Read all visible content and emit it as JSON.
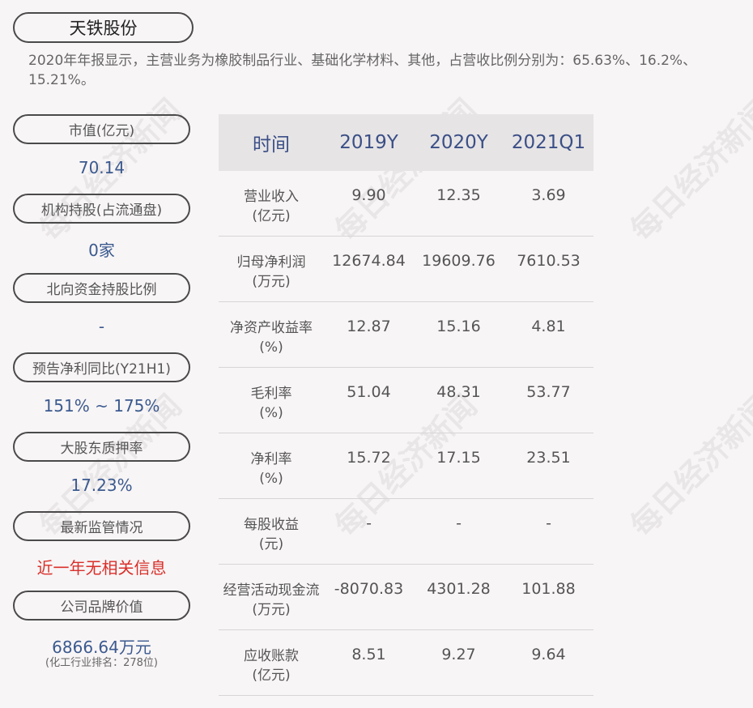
{
  "company": "天铁股份",
  "summary": "2020年年报显示，主营业务为橡胶制品行业、基础化学材料、其他，占营收比例分别为：65.63%、16.2%、15.21%。",
  "metrics": [
    {
      "label": "市值(亿元)",
      "value": "70.14"
    },
    {
      "label": "机构持股(占流通盘)",
      "value": "0家"
    },
    {
      "label": "北向资金持股比例",
      "value": "-"
    },
    {
      "label": "预告净利同比(Y21H1)",
      "value": "151% ~ 175%"
    },
    {
      "label": "大股东质押率",
      "value": "17.23%"
    },
    {
      "label": "最新监管情况",
      "value": "近一年无相关信息"
    },
    {
      "label": "公司品牌价值",
      "value": "6866.64万元",
      "sub": "(化工行业排名：278位)"
    }
  ],
  "table": {
    "headers": [
      "时间",
      "2019Y",
      "2020Y",
      "2021Q1"
    ],
    "rows": [
      {
        "label1": "营业收入",
        "label2": "(亿元)",
        "values": [
          "9.90",
          "12.35",
          "3.69"
        ]
      },
      {
        "label1": "归母净利润",
        "label2": "(万元)",
        "values": [
          "12674.84",
          "19609.76",
          "7610.53"
        ]
      },
      {
        "label1": "净资产收益率",
        "label2": "(%)",
        "values": [
          "12.87",
          "15.16",
          "4.81"
        ]
      },
      {
        "label1": "毛利率",
        "label2": "(%)",
        "values": [
          "51.04",
          "48.31",
          "53.77"
        ]
      },
      {
        "label1": "净利率",
        "label2": "(%)",
        "values": [
          "15.72",
          "17.15",
          "23.51"
        ]
      },
      {
        "label1": "每股收益",
        "label2": "(元)",
        "values": [
          "-",
          "-",
          "-"
        ]
      },
      {
        "label1": "经营活动现金流",
        "label2": "(万元)",
        "values": [
          "-8070.83",
          "4301.28",
          "101.88"
        ]
      },
      {
        "label1": "应收账款",
        "label2": "(亿元)",
        "values": [
          "8.51",
          "9.27",
          "9.64"
        ]
      }
    ]
  },
  "watermark": "每日经济新闻"
}
